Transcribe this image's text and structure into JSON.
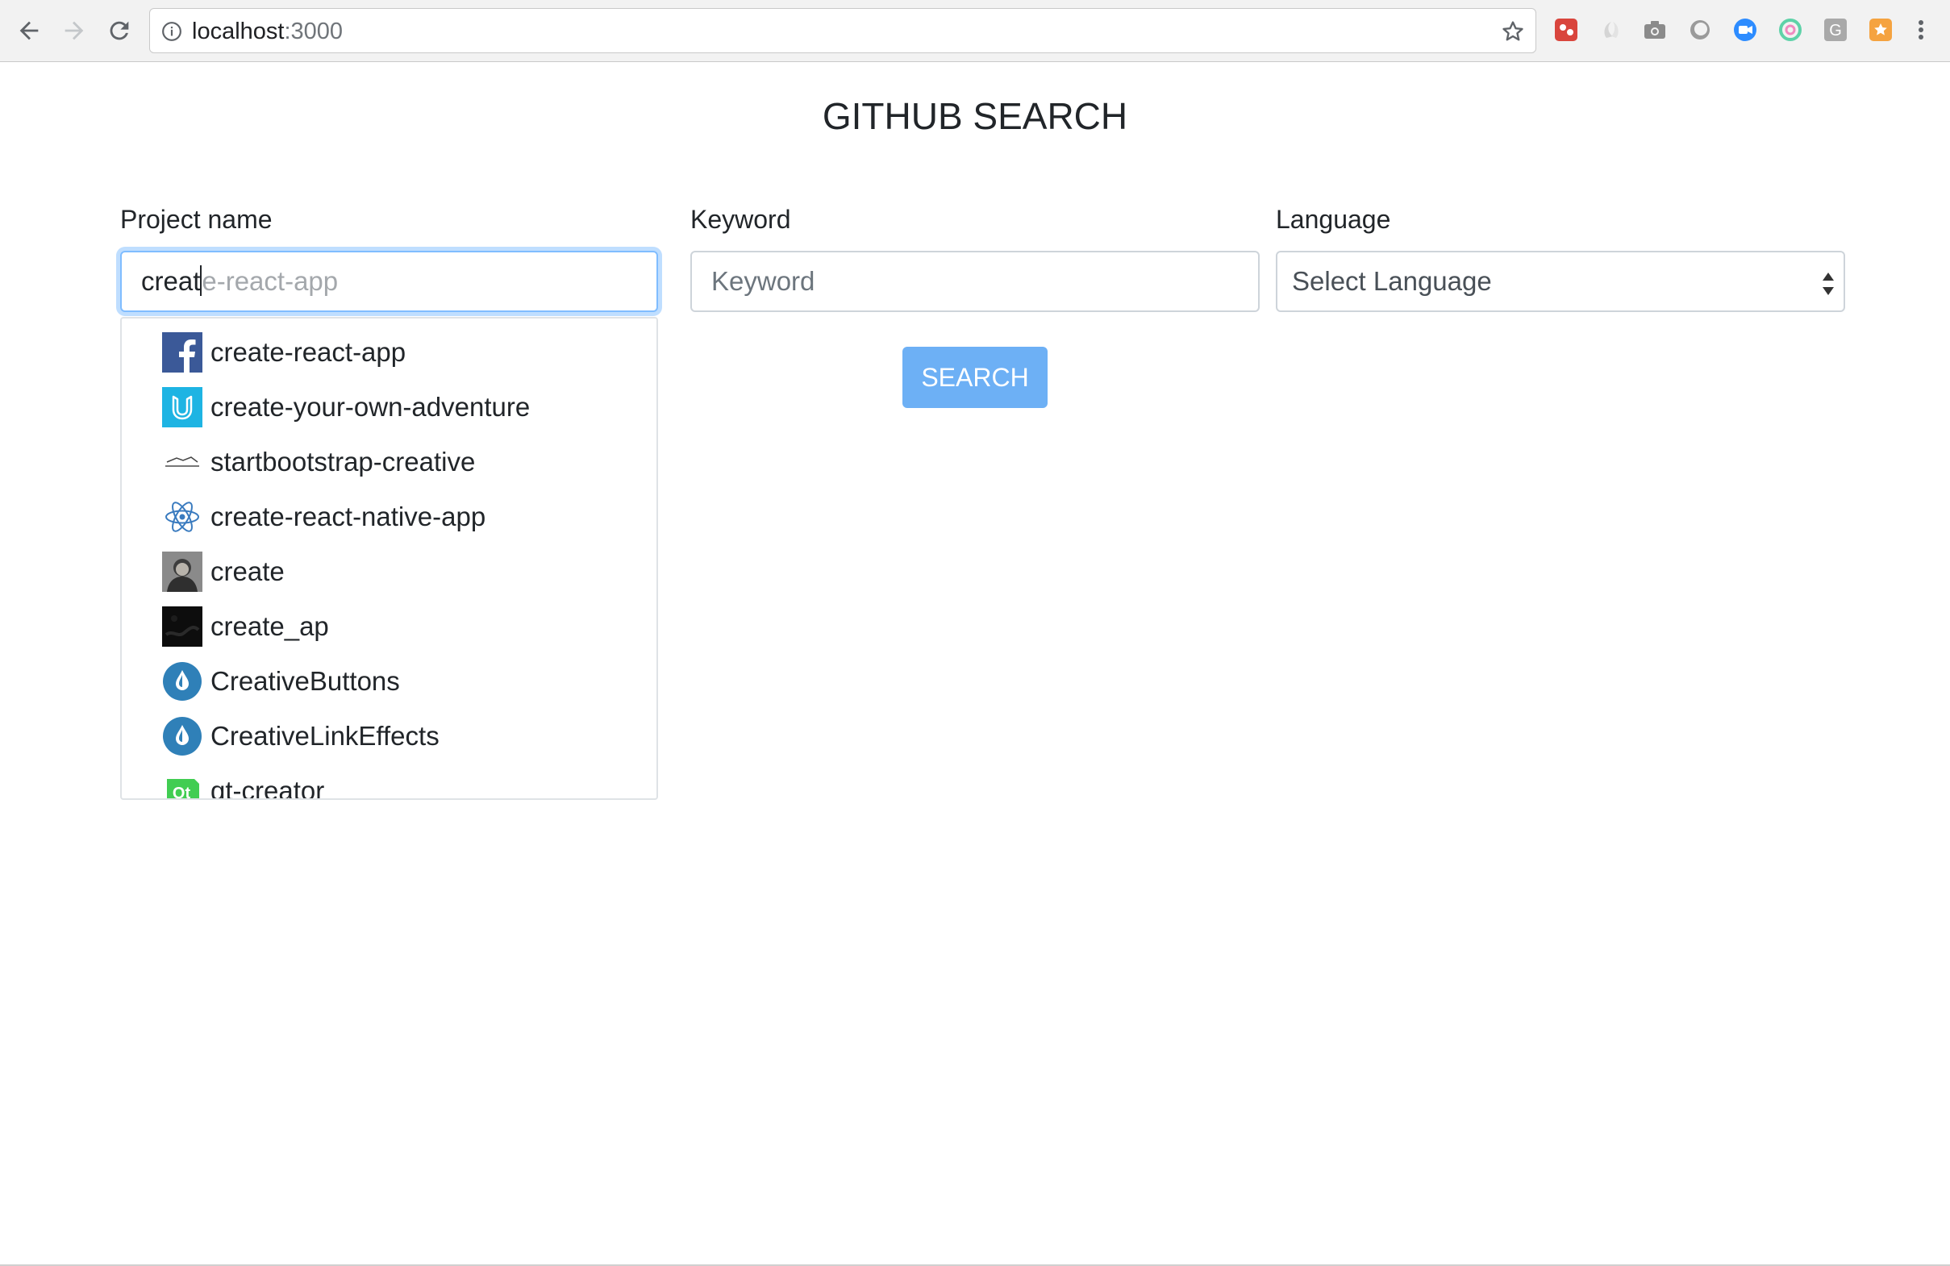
{
  "browser": {
    "url_host": "localhost",
    "url_port": ":3000",
    "extensions": [
      "screenshot-ext-icon",
      "ghost-ext-icon",
      "camera-ext-icon",
      "circle-ext-icon",
      "video-ext-icon",
      "ring-ext-icon",
      "g-ext-icon",
      "orange-ext-icon"
    ]
  },
  "page": {
    "title": "GITHUB SEARCH"
  },
  "form": {
    "project": {
      "label": "Project name",
      "typed": "creat",
      "autocomplete_hint": "e-react-app"
    },
    "keyword": {
      "label": "Keyword",
      "placeholder": "Keyword"
    },
    "language": {
      "label": "Language",
      "selected": "Select Language"
    },
    "search_label": "SEARCH"
  },
  "suggestions": [
    {
      "name": "create-react-app",
      "icon": "facebook-logo-icon"
    },
    {
      "name": "create-your-own-adventure",
      "icon": "udacity-logo-icon"
    },
    {
      "name": "startbootstrap-creative",
      "icon": "blackrock-logo-icon"
    },
    {
      "name": "create-react-native-app",
      "icon": "react-logo-icon"
    },
    {
      "name": "create",
      "icon": "user-avatar-icon"
    },
    {
      "name": "create_ap",
      "icon": "dark-avatar-icon"
    },
    {
      "name": "CreativeButtons",
      "icon": "codrops-logo-icon"
    },
    {
      "name": "CreativeLinkEffects",
      "icon": "codrops-logo-icon"
    },
    {
      "name": "qt-creator",
      "icon": "qt-logo-icon"
    }
  ],
  "colors": {
    "focus_border": "#80bdff",
    "button_bg": "#6db0f5"
  }
}
